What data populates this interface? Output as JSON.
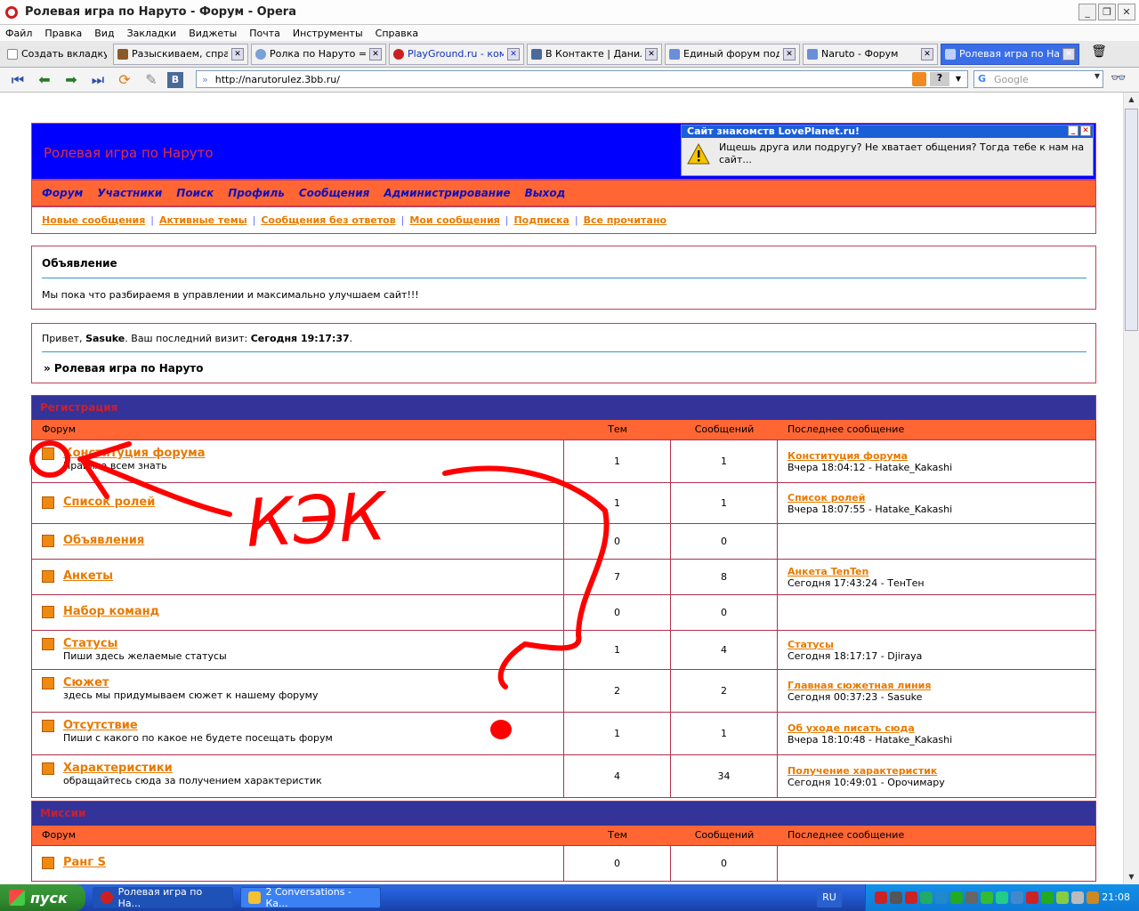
{
  "window": {
    "title": "Ролевая игра по Наруто - Форум - Opera"
  },
  "menu": [
    "Файл",
    "Правка",
    "Вид",
    "Закладки",
    "Виджеты",
    "Почта",
    "Инструменты",
    "Справка"
  ],
  "tabs": {
    "new_tab": "Создать вкладку",
    "items": [
      {
        "label": "Разыскиваем, спра..."
      },
      {
        "label": "Ролка по Наруто =)"
      },
      {
        "label": "PlayGround.ru - ком..."
      },
      {
        "label": "В Контакте | Данил..."
      },
      {
        "label": "Единый форум под..."
      },
      {
        "label": "Naruto - Форум"
      },
      {
        "label": "Ролевая игра по На..."
      }
    ]
  },
  "address": {
    "url": "http://narutorulez.3bb.ru/",
    "search_placeholder": "Google"
  },
  "page": {
    "site_title": "Ролевая игра по Наруто",
    "ad": {
      "title": "Сайт знакомств LovePlanet.ru!",
      "text": "Ищешь друга или подругу? Не хватает общения? Тогда тебе к нам на сайт..."
    },
    "nav": [
      "Форум",
      "Участники",
      "Поиск",
      "Профиль",
      "Сообщения",
      "Администрирование",
      "Выход"
    ],
    "subnav": [
      "Новые сообщения",
      "Активные темы",
      "Сообщения без ответов",
      "Мои сообщения",
      "Подписка",
      "Все прочитано"
    ],
    "announcement": {
      "heading": "Объявление",
      "text": "Мы пока что разбираемя в управлении и максимально улучшаем сайт!!!"
    },
    "welcome": {
      "prefix": "Привет,",
      "user": "Sasuke",
      "mid": ".  Ваш последний визит:",
      "visit": "Сегодня 19:17:37",
      "suffix": ".",
      "crumb": "» Ролевая игра по Наруто"
    },
    "columns": {
      "forum": "Форум",
      "topics": "Тем",
      "posts": "Сообщений",
      "last": "Последнее сообщение"
    },
    "categories": [
      {
        "name": "Регистрация",
        "forums": [
          {
            "name": "Конституция форума",
            "desc": "Правила всем знать",
            "topics": "1",
            "posts": "1",
            "last_title": "Конституция форума",
            "last_info": "Вчера 18:04:12 - Hatake_Kakashi"
          },
          {
            "name": "Список ролей",
            "desc": "",
            "topics": "1",
            "posts": "1",
            "last_title": "Список ролей",
            "last_info": "Вчера 18:07:55 - Hatake_Kakashi"
          },
          {
            "name": "Объявления",
            "desc": "",
            "topics": "0",
            "posts": "0",
            "last_title": "",
            "last_info": ""
          },
          {
            "name": "Анкеты",
            "desc": "",
            "topics": "7",
            "posts": "8",
            "last_title": "Анкета TenTen",
            "last_info": "Сегодня 17:43:24 - ТенТен"
          },
          {
            "name": "Набор команд",
            "desc": "",
            "topics": "0",
            "posts": "0",
            "last_title": "",
            "last_info": ""
          },
          {
            "name": "Статусы",
            "desc": "Пиши здесь желаемые статусы",
            "topics": "1",
            "posts": "4",
            "last_title": "Статусы",
            "last_info": "Сегодня 18:17:17 - Djiraya"
          },
          {
            "name": "Сюжет",
            "desc": "здесь мы придумываем сюжет к нашему форуму",
            "topics": "2",
            "posts": "2",
            "last_title": "Главная сюжетная линия",
            "last_info": "Сегодня 00:37:23 - Sasuke"
          },
          {
            "name": "Отсутствие",
            "desc": "Пиши с какого по какое не будете посещать форум",
            "topics": "1",
            "posts": "1",
            "last_title": "Об уходе писать сюда",
            "last_info": "Вчера 18:10:48 - Hatake_Kakashi"
          },
          {
            "name": "Характеристики",
            "desc": "обращайтесь сюда за получением характеристик",
            "topics": "4",
            "posts": "34",
            "last_title": "Получение характеристик",
            "last_info": "Сегодня 10:49:01 - Орочимару"
          }
        ]
      },
      {
        "name": "Миссии",
        "forums": [
          {
            "name": "Ранг S",
            "desc": "",
            "topics": "0",
            "posts": "0",
            "last_title": "",
            "last_info": ""
          }
        ]
      }
    ],
    "scribble_text": "КЭК"
  },
  "taskbar": {
    "start": "пуск",
    "items": [
      {
        "label": "Ролевая игра по На..."
      },
      {
        "label": "2 Conversations - Ка..."
      }
    ],
    "lang": "RU",
    "clock": "21:08"
  }
}
